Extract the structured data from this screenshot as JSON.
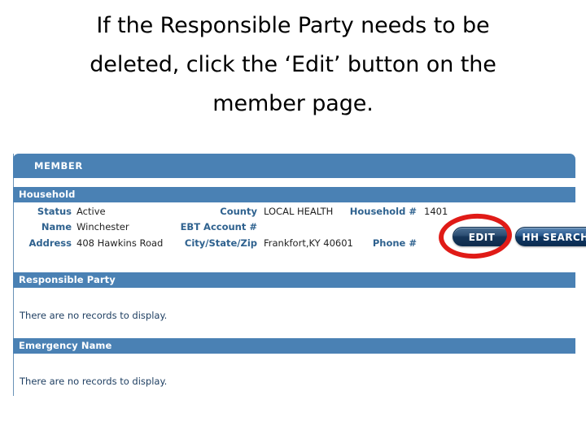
{
  "caption": {
    "lines": [
      "If the Responsible Party needs to be",
      "deleted, click the ‘Edit’ button on the",
      "member page."
    ]
  },
  "app": {
    "module_tab": "MEMBER",
    "sections": {
      "household": {
        "title": "Household",
        "fields": [
          {
            "label": "Status",
            "value": "Active"
          },
          {
            "label": "Name",
            "value": "Winchester"
          },
          {
            "label": "Address",
            "value": "408 Hawkins Road"
          },
          {
            "label": "County",
            "value": "LOCAL HEALTH"
          },
          {
            "label": "EBT Account #",
            "value": ""
          },
          {
            "label": "City/State/Zip",
            "value": "Frankfort,KY 40601"
          },
          {
            "label": "Household #",
            "value": "1401"
          },
          {
            "label": "Phone #",
            "value": ""
          }
        ]
      },
      "responsible_party": {
        "title": "Responsible Party",
        "empty_message": "There are no records to display."
      },
      "emergency_name": {
        "title": "Emergency Name",
        "empty_message": "There are no records to display."
      }
    },
    "buttons": {
      "edit": "EDIT",
      "hh_search": "HH SEARCH"
    },
    "annotation": {
      "shape": "ellipse-highlight",
      "target": "EDIT",
      "color": "#e01b17"
    },
    "colors": {
      "bar_blue": "#4a81b4",
      "label_blue": "#2f628f",
      "button_navy": "#0f2b4c",
      "annotation_red": "#e01b17"
    }
  }
}
